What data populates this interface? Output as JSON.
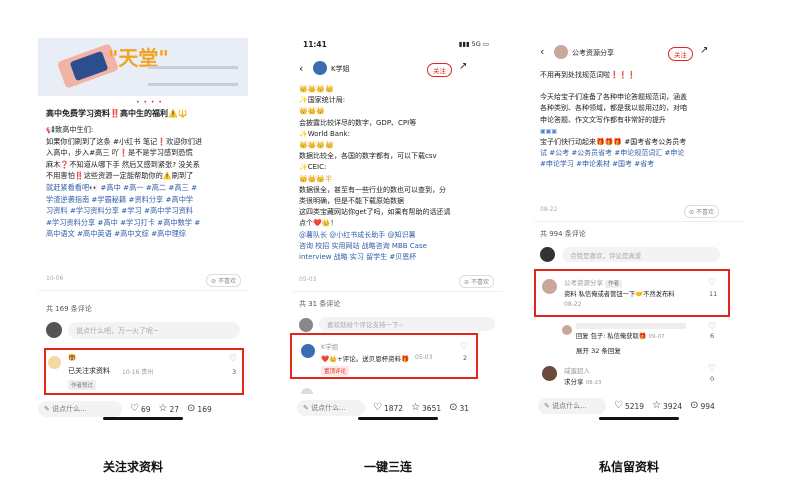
{
  "phone1": {
    "banner_text": "\"天堂\"",
    "dots": "• • • •",
    "title": "高中免费学习资料‼️高中生的福利⚠️🔱",
    "greeting": "📢致高中生们:",
    "body_lines": [
      "如果你们刷到了这条 #小红书 笔记❗欢迎你们进",
      "入高中，步入#高三 吖❗是不是学习感到恐慌",
      "麻木❓不知道从哪下手 然后又感到紧张? 没关系",
      "不用害怕‼️这些资源一定能帮助你的⚠️刷到了",
      "就赶紧看看吧👀 #高中 #高一 #高二 #高三 #",
      "学渣逆袭指南 #学霸秘籍 #资料分享 #高中学",
      "习资料 #学习资料分享 #学习 #高中学习资料",
      "#学习资料分享 #高中 #学习打卡 #高中数学 #",
      "高中语文 #高中英语 #高中文综 #高中理综"
    ],
    "date": "10-06",
    "not_like": "不喜欢",
    "total_comments": "共 169 条评论",
    "input_placeholder": "说点什么吧，万一火了呢~",
    "comment": {
      "name": "🐯",
      "text": "已关注求资料",
      "meta": "10-16 贵州",
      "tag": "作者赞过",
      "likes": "3"
    },
    "bottom": {
      "say": "说点什么...",
      "likes": "69",
      "stars": "27",
      "comments": "169"
    }
  },
  "phone2": {
    "time": "11:41",
    "signal": "5G",
    "account": "K学姐",
    "follow": "关注",
    "body_lines": [
      "👑👑👑👑",
      "✨国家统计局:",
      "👑👑👑",
      "会披露比较详尽的数字，GDP、CPI等",
      "✨World Bank:",
      "👑👑👑👑",
      "数据比较全，各国的数字都有，可以下载csv",
      "✨CEIC:",
      "👑👑👑半",
      "数据很全，甚至有一些行业的数也可以查到，分",
      "类很明确，但是不能下载原始数据",
      "这四类宝藏网站你get了吗，如果有帮助的话还请",
      "点个❤️👑！",
      "@薯队长 @小红书成长助手 @知识薯",
      "咨询 校招 实用网站 战略咨询 MBB Case",
      "interview 战略 实习 留学生 #贝恩杯"
    ],
    "date": "05-03",
    "not_like": "不喜欢",
    "total_comments": "共 31 条评论",
    "input_placeholder": "喜欢就给个评论支持一下~",
    "comment": {
      "name": "K学姐",
      "text": "❤️👑+评论。送贝恩杯资料🎁",
      "meta": "05-03",
      "tag": "置顶评论",
      "likes": "2"
    },
    "bottom": {
      "say": "说点什么...",
      "likes": "1872",
      "stars": "3651",
      "comments": "31"
    }
  },
  "phone3": {
    "account": "公考资源分享",
    "follow": "关注",
    "body_lines": [
      "不用再到处找规范词啦❗❗❗",
      "",
      "今天给宝子们准备了各种申论答题规范词，涵盖",
      "各种类别、各种领域，都是我以前用过的，对咱",
      "申论答题、作文文写作都有非常好的提升",
      "",
      "宝子们快行动起来🎁🎁🎁 #国考省考公务员考",
      "试 #公考 #公务员省考 #申论规范词汇 #申论",
      "#申论学习 #申论素材 #国考 #省考"
    ],
    "date": "08-22",
    "not_like": "不喜欢",
    "total_comments": "共 994 条评论",
    "input_placeholder": "点赞是喜欢，评论是真爱",
    "comment": {
      "name": "公考资源分享",
      "author_tag": "作者",
      "text": "资料  私信俺或者管钮一下🤝不然发布料",
      "meta": "08-22",
      "likes": "11"
    },
    "reply": {
      "text": "回复 包子: 私信俺获取🎁",
      "meta": "09-07",
      "likes": "6",
      "expand": "展开 32 条回复"
    },
    "comment2": {
      "name": "咸蛋超人",
      "text": "求分享",
      "meta": "08-23",
      "likes": "0"
    },
    "bottom": {
      "say": "说点什么...",
      "likes": "5219",
      "stars": "3924",
      "comments": "994"
    }
  },
  "captions": [
    "关注求资料",
    "一键三连",
    "私信留资料"
  ],
  "colors": {
    "highlight": "#e3261b",
    "hashtag": "#2f5ea8"
  }
}
